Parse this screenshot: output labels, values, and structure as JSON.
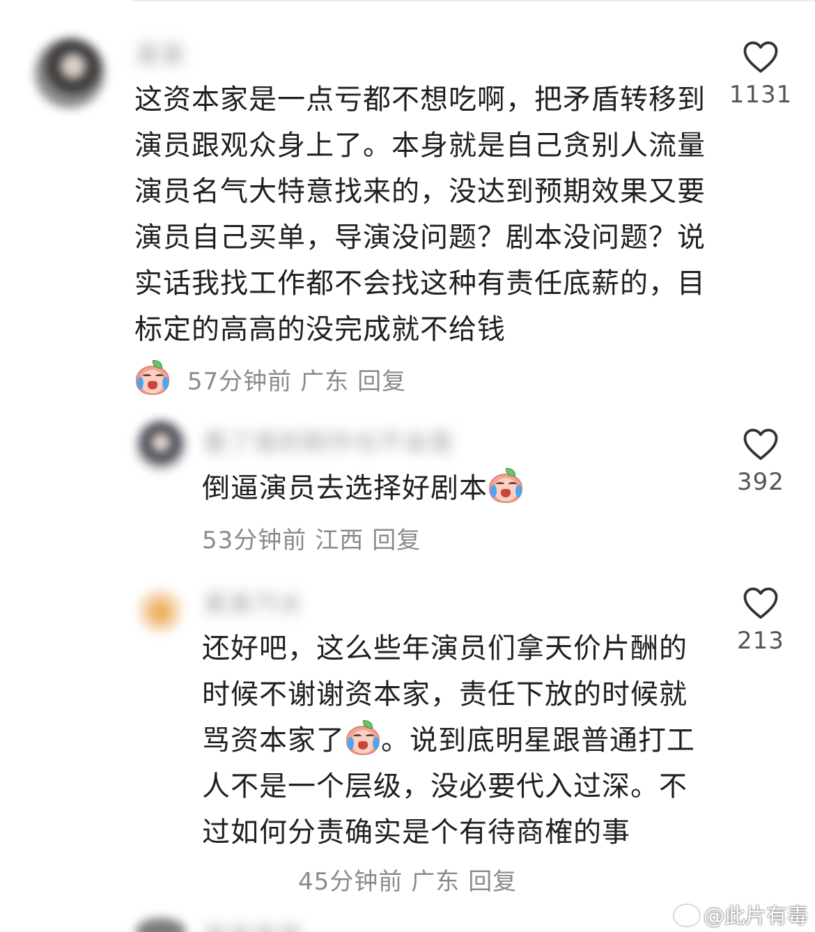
{
  "comments": [
    {
      "username": "某某",
      "text": "这资本家是一点亏都不想吃啊，把矛盾转移到演员跟观众身上了。本身就是自己贪别人流量演员名气大特意找来的，没达到预期效果又要演员自己买单，导演没问题？剧本没问题？说实话我找工作都不会找这种有责任底薪的，目标定的高高的没完成就不给钱",
      "time": "57分钟前",
      "location": "广东",
      "reply_label": "回复",
      "likes": "1131",
      "reaction_icon": "crying-peach-emoji"
    },
    {
      "username": "看了我的制作也不会是",
      "text": "倒逼演员去选择好剧本",
      "time": "53分钟前",
      "location": "江西",
      "reply_label": "回复",
      "likes": "392",
      "reaction_icon": "crying-peach-emoji"
    },
    {
      "username": "某某汽水",
      "text_part1": "还好吧，这么些年演员们拿天价片酬的时候不谢谢资本家，责任下放的时候就骂资本家了",
      "text_part2": "。说到底明星跟普通打工人不是一个层级，没必要代入过深。不过如何分责确实是个有待商榷的事",
      "time": "45分钟前",
      "location": "广东",
      "reply_label": "回复",
      "likes": "213",
      "reaction_icon": "crying-peach-emoji"
    },
    {
      "username": "某某某某"
    }
  ],
  "watermark": "@此片有毒",
  "icons": {
    "like": "heart-outline-icon",
    "watermark": "weibo-logo-icon"
  }
}
